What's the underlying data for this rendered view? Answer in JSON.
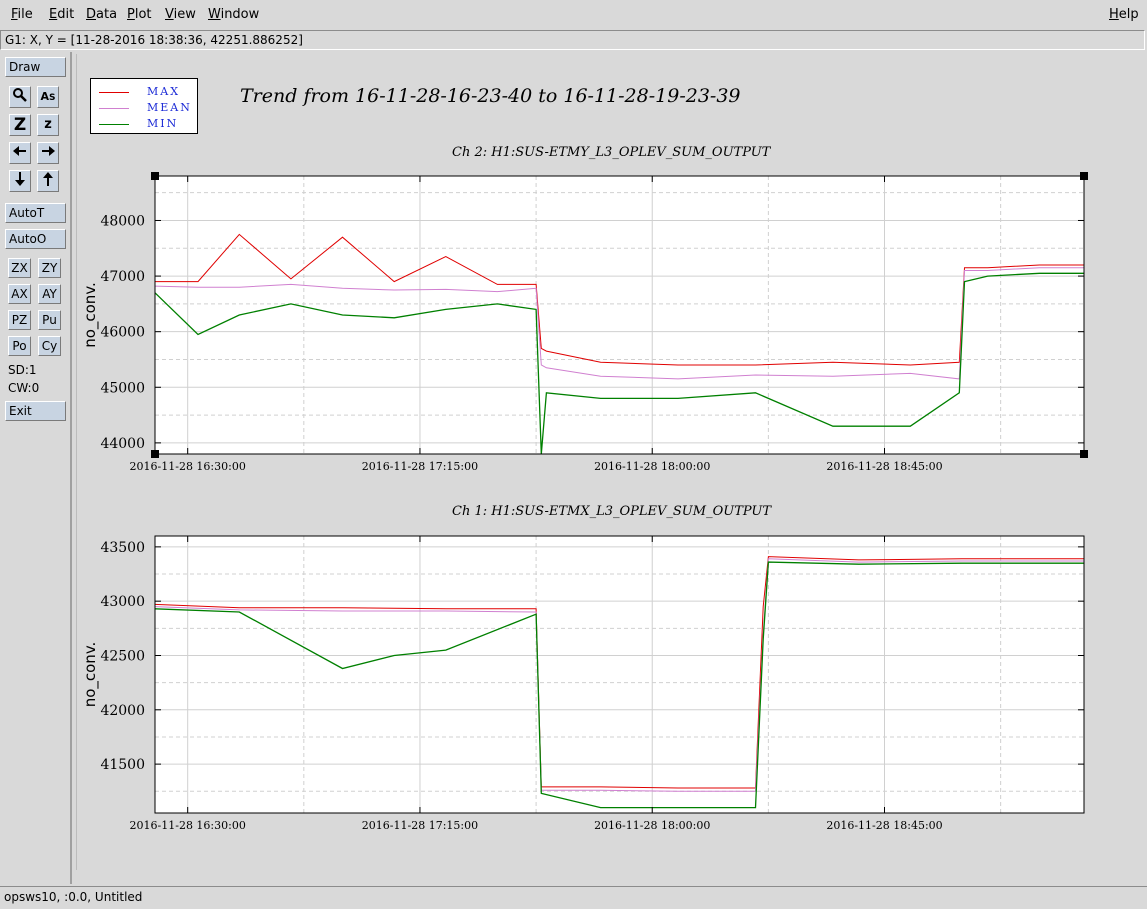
{
  "menu": {
    "file": "File",
    "edit": "Edit",
    "data": "Data",
    "plot": "Plot",
    "view": "View",
    "window": "Window",
    "help": "Help"
  },
  "coord_readout": "G1: X, Y = [11-28-2016 18:38:36, 42251.886252]",
  "toolbar": {
    "draw": "Draw",
    "autot": "AutoT",
    "autoo": "AutoO",
    "zx": "ZX",
    "zy": "ZY",
    "ax": "AX",
    "ay": "AY",
    "pz": "PZ",
    "pu": "Pu",
    "po": "Po",
    "cy": "Cy",
    "sd": "SD:1",
    "cw": "CW:0",
    "exit": "Exit",
    "icons": [
      "magnifier-icon",
      "text-as-icon",
      "zoom-big-icon",
      "zoom-small-icon",
      "arrow-left-icon",
      "arrow-right-icon",
      "arrow-down-icon",
      "arrow-up-icon"
    ]
  },
  "status": "opsws10, :0.0, Untitled",
  "trend_title": "Trend from 16-11-28-16-23-40 to 16-11-28-19-23-39",
  "legend": [
    {
      "label": "MAX",
      "color": "#e00000"
    },
    {
      "label": "MEAN",
      "color": "#d080d0"
    },
    {
      "label": "MIN",
      "color": "#008000"
    }
  ],
  "chart_data": [
    {
      "type": "line",
      "title": "Ch 2: H1:SUS-ETMY_L3_OPLEV_SUM_OUTPUT",
      "ylabel": "no_conv.",
      "xlabel": "",
      "xlim": [
        "2016-11-28 16:23:40",
        "2016-11-28 19:23:39"
      ],
      "ylim": [
        43800,
        48800
      ],
      "yticks": [
        44000,
        45000,
        46000,
        47000,
        48000
      ],
      "xticks": [
        "2016-11-28 16:30:00",
        "2016-11-28 17:15:00",
        "2016-11-28 18:00:00",
        "2016-11-28 18:45:00"
      ],
      "grid": true,
      "series": [
        {
          "name": "MAX",
          "color": "#e00000",
          "x": [
            "2016-11-28 16:23:40",
            "2016-11-28 16:32:00",
            "2016-11-28 16:40:00",
            "2016-11-28 16:50:00",
            "2016-11-28 17:00:00",
            "2016-11-28 17:10:00",
            "2016-11-28 17:20:00",
            "2016-11-28 17:30:00",
            "2016-11-28 17:37:30",
            "2016-11-28 17:38:30",
            "2016-11-28 17:39:30",
            "2016-11-28 17:50:00",
            "2016-11-28 18:05:00",
            "2016-11-28 18:20:00",
            "2016-11-28 18:35:00",
            "2016-11-28 18:50:00",
            "2016-11-28 18:59:30",
            "2016-11-28 19:00:30",
            "2016-11-28 19:05:00",
            "2016-11-28 19:15:00",
            "2016-11-28 19:23:39"
          ],
          "y": [
            46900,
            46900,
            47750,
            46950,
            47700,
            46900,
            47350,
            46850,
            46850,
            45700,
            45650,
            45450,
            45400,
            45400,
            45450,
            45400,
            45450,
            47150,
            47150,
            47200,
            47200
          ]
        },
        {
          "name": "MEAN",
          "color": "#d080d0",
          "x": [
            "2016-11-28 16:23:40",
            "2016-11-28 16:32:00",
            "2016-11-28 16:40:00",
            "2016-11-28 16:50:00",
            "2016-11-28 17:00:00",
            "2016-11-28 17:10:00",
            "2016-11-28 17:20:00",
            "2016-11-28 17:30:00",
            "2016-11-28 17:37:30",
            "2016-11-28 17:38:30",
            "2016-11-28 17:39:30",
            "2016-11-28 17:50:00",
            "2016-11-28 18:05:00",
            "2016-11-28 18:20:00",
            "2016-11-28 18:35:00",
            "2016-11-28 18:50:00",
            "2016-11-28 18:59:30",
            "2016-11-28 19:00:30",
            "2016-11-28 19:05:00",
            "2016-11-28 19:15:00",
            "2016-11-28 19:23:39"
          ],
          "y": [
            46820,
            46800,
            46800,
            46850,
            46780,
            46750,
            46760,
            46720,
            46780,
            45400,
            45350,
            45200,
            45150,
            45220,
            45200,
            45250,
            45150,
            47100,
            47100,
            47150,
            47150
          ]
        },
        {
          "name": "MIN",
          "color": "#008000",
          "x": [
            "2016-11-28 16:23:40",
            "2016-11-28 16:32:00",
            "2016-11-28 16:40:00",
            "2016-11-28 16:50:00",
            "2016-11-28 17:00:00",
            "2016-11-28 17:10:00",
            "2016-11-28 17:20:00",
            "2016-11-28 17:30:00",
            "2016-11-28 17:37:30",
            "2016-11-28 17:38:30",
            "2016-11-28 17:39:30",
            "2016-11-28 17:50:00",
            "2016-11-28 18:05:00",
            "2016-11-28 18:20:00",
            "2016-11-28 18:35:00",
            "2016-11-28 18:50:00",
            "2016-11-28 18:59:30",
            "2016-11-28 19:00:30",
            "2016-11-28 19:05:00",
            "2016-11-28 19:15:00",
            "2016-11-28 19:23:39"
          ],
          "y": [
            46700,
            45950,
            46300,
            46500,
            46300,
            46250,
            46400,
            46500,
            46400,
            43800,
            44900,
            44800,
            44800,
            44900,
            44300,
            44300,
            44900,
            46900,
            47000,
            47050,
            47050
          ]
        }
      ]
    },
    {
      "type": "line",
      "title": "Ch 1: H1:SUS-ETMX_L3_OPLEV_SUM_OUTPUT",
      "ylabel": "no_conv.",
      "xlabel": "",
      "xlim": [
        "2016-11-28 16:23:40",
        "2016-11-28 19:23:39"
      ],
      "ylim": [
        41050,
        43600
      ],
      "yticks": [
        41500,
        42000,
        42500,
        43000,
        43500
      ],
      "xticks": [
        "2016-11-28 16:30:00",
        "2016-11-28 17:15:00",
        "2016-11-28 18:00:00",
        "2016-11-28 18:45:00"
      ],
      "grid": true,
      "series": [
        {
          "name": "MAX",
          "color": "#e00000",
          "x": [
            "2016-11-28 16:23:40",
            "2016-11-28 16:40:00",
            "2016-11-28 17:00:00",
            "2016-11-28 17:20:00",
            "2016-11-28 17:37:30",
            "2016-11-28 17:38:30",
            "2016-11-28 17:50:00",
            "2016-11-28 18:05:00",
            "2016-11-28 18:20:00",
            "2016-11-28 18:21:30",
            "2016-11-28 18:22:30",
            "2016-11-28 18:40:00",
            "2016-11-28 19:00:00",
            "2016-11-28 19:23:39"
          ],
          "y": [
            42970,
            42940,
            42940,
            42930,
            42930,
            41290,
            41290,
            41280,
            41280,
            42950,
            43410,
            43380,
            43390,
            43390
          ]
        },
        {
          "name": "MEAN",
          "color": "#d080d0",
          "x": [
            "2016-11-28 16:23:40",
            "2016-11-28 16:40:00",
            "2016-11-28 17:00:00",
            "2016-11-28 17:20:00",
            "2016-11-28 17:37:30",
            "2016-11-28 17:38:30",
            "2016-11-28 17:50:00",
            "2016-11-28 18:05:00",
            "2016-11-28 18:20:00",
            "2016-11-28 18:21:30",
            "2016-11-28 18:22:30",
            "2016-11-28 18:40:00",
            "2016-11-28 19:00:00",
            "2016-11-28 19:23:39"
          ],
          "y": [
            42950,
            42920,
            42910,
            42910,
            42900,
            41260,
            41260,
            41250,
            41250,
            42700,
            43390,
            43360,
            43370,
            43370
          ]
        },
        {
          "name": "MIN",
          "color": "#008000",
          "x": [
            "2016-11-28 16:23:40",
            "2016-11-28 16:40:00",
            "2016-11-28 17:00:00",
            "2016-11-28 17:10:00",
            "2016-11-28 17:20:00",
            "2016-11-28 17:37:30",
            "2016-11-28 17:38:30",
            "2016-11-28 17:50:00",
            "2016-11-28 18:05:00",
            "2016-11-28 18:20:00",
            "2016-11-28 18:21:30",
            "2016-11-28 18:22:30",
            "2016-11-28 18:40:00",
            "2016-11-28 19:00:00",
            "2016-11-28 19:23:39"
          ],
          "y": [
            42930,
            42900,
            42380,
            42500,
            42550,
            42880,
            41230,
            41100,
            41100,
            41100,
            42650,
            43360,
            43340,
            43350,
            43350
          ]
        }
      ]
    }
  ]
}
